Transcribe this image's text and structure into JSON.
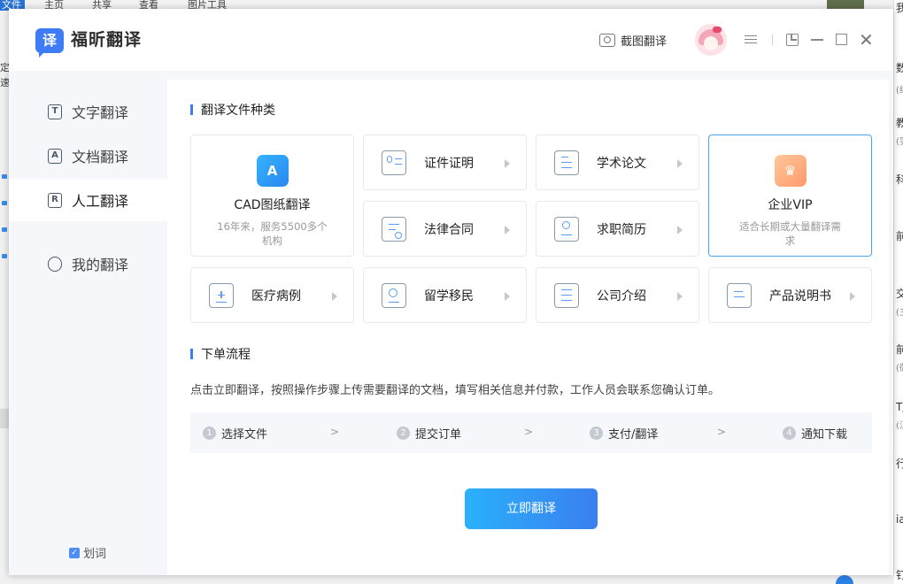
{
  "background_app": {
    "top_tabs": [
      "文件",
      "主页",
      "共享",
      "查看",
      "图片工具"
    ],
    "left_fragments": [
      "定",
      "速"
    ],
    "right_fragments": [
      {
        "text": "我（文",
        "small": false
      },
      {
        "text": "数",
        "small": false
      },
      {
        "text": "(纯",
        "small": true
      },
      {
        "text": "教",
        "small": false
      },
      {
        "text": "(实",
        "small": true
      },
      {
        "text": "科",
        "small": false
      },
      {
        "text": "前",
        "small": false
      },
      {
        "text": "交",
        "small": false
      },
      {
        "text": "(主",
        "small": true
      },
      {
        "text": "前",
        "small": false
      },
      {
        "text": "(御",
        "small": true
      },
      {
        "text": "T/",
        "small": false
      },
      {
        "text": "(汉",
        "small": true
      },
      {
        "text": "行",
        "small": false
      },
      {
        "text": "ia",
        "small": false
      },
      {
        "text": "钉钉",
        "small": false
      }
    ]
  },
  "window": {
    "logo_char": "译",
    "app_name": "福昕翻译",
    "screenshot_label": "截图翻译",
    "close_glyph": "✕"
  },
  "sidebar": {
    "items": [
      {
        "label": "文字翻译",
        "icon_char": "T"
      },
      {
        "label": "文档翻译",
        "icon_char": "A"
      },
      {
        "label": "人工翻译",
        "icon_char": "R"
      },
      {
        "label": "我的翻译",
        "icon_char": ""
      }
    ],
    "active_index": 2,
    "highlight_label": "划词",
    "highlight_checked": true
  },
  "main": {
    "section1_title": "翻译文件种类",
    "cad_card": {
      "icon": "A",
      "title": "CAD图纸翻译",
      "desc": "16年来，服务5500多个机构"
    },
    "vip_card": {
      "title": "企业VIP",
      "desc": "适合长期或大量翻译需求"
    },
    "cards": [
      {
        "label": "证件证明"
      },
      {
        "label": "学术论文"
      },
      {
        "label": "法律合同"
      },
      {
        "label": "求职简历"
      },
      {
        "label": "医疗病例"
      },
      {
        "label": "留学移民"
      },
      {
        "label": "公司介绍"
      },
      {
        "label": "产品说明书"
      }
    ],
    "section2_title": "下单流程",
    "process_desc": "点击立即翻译，按照操作步骤上传需要翻译的文档，填写相关信息并付款，工作人员会联系您确认订单。",
    "steps": [
      {
        "num": "1",
        "label": "选择文件"
      },
      {
        "num": "2",
        "label": "提交订单"
      },
      {
        "num": "3",
        "label": "支付/翻译"
      },
      {
        "num": "4",
        "label": "通知下载"
      }
    ],
    "step_separator": ">",
    "button_label": "立即翻译"
  }
}
